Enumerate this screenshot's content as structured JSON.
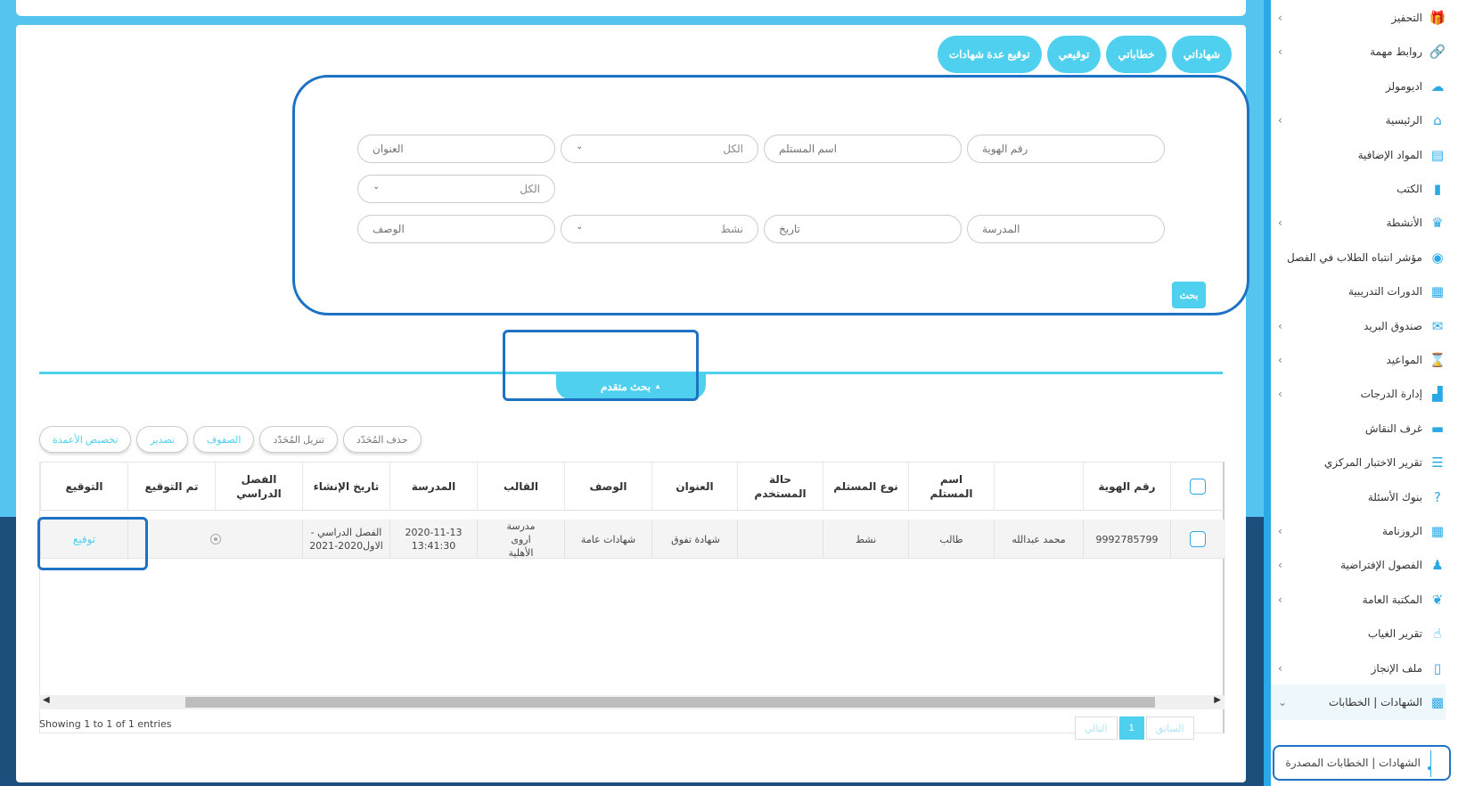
{
  "sidebar": {
    "items": [
      {
        "label": "التحفيز",
        "icon": "gift-icon",
        "chevron": true
      },
      {
        "label": "روابط مهمة",
        "icon": "link-icon",
        "chevron": true
      },
      {
        "label": "اديومولز",
        "icon": "cloud-icon",
        "chevron": false
      },
      {
        "label": "الرئيسية",
        "icon": "home-icon",
        "chevron": true
      },
      {
        "label": "المواد الإضافية",
        "icon": "documents-icon",
        "chevron": false
      },
      {
        "label": "الكتب",
        "icon": "book-icon",
        "chevron": false
      },
      {
        "label": "الأنشطة",
        "icon": "trophy-icon",
        "chevron": true
      },
      {
        "label": "مؤشر انتباه الطلاب في الفصل",
        "icon": "eye-icon",
        "chevron": false
      },
      {
        "label": "الدورات التدريبية",
        "icon": "grid-icon",
        "chevron": false
      },
      {
        "label": "صندوق البريد",
        "icon": "mail-icon",
        "chevron": true
      },
      {
        "label": "المواعيد",
        "icon": "hourglass-icon",
        "chevron": true
      },
      {
        "label": "إدارة الدرجات",
        "icon": "bar-chart-icon",
        "chevron": true
      },
      {
        "label": "غرف النقاش",
        "icon": "chat-icon",
        "chevron": false
      },
      {
        "label": "تقرير الاختبار المركزي",
        "icon": "list-icon",
        "chevron": false
      },
      {
        "label": "بنوك الأسئلة",
        "icon": "question-icon",
        "chevron": false
      },
      {
        "label": "الروزنامة",
        "icon": "calendar-icon",
        "chevron": true
      },
      {
        "label": "الفصول الإفتراضية",
        "icon": "users-icon",
        "chevron": true
      },
      {
        "label": "المكتبة العامة",
        "icon": "leaf-icon",
        "chevron": true
      },
      {
        "label": "تقرير الغياب",
        "icon": "hand-icon",
        "chevron": false
      },
      {
        "label": "ملف الإنجاز",
        "icon": "file-icon",
        "chevron": true
      },
      {
        "label": "الشهادات | الخطابات",
        "icon": "qr-icon",
        "chevron": true
      }
    ],
    "sub_item": "الشهادات | الخطابات المصدرة"
  },
  "tabs": [
    "شهاداتي",
    "خطاباتي",
    "توقيعي",
    "توقيع عدة شهادات"
  ],
  "filters": {
    "id_number": "رقم الهوية",
    "recipient_name": "اسم المستلم",
    "type_select": "الكل",
    "title": "العنوان",
    "second_select": "الكل",
    "school": "المدرسة",
    "date": "تاريخ",
    "status_select": "نشط",
    "description": "الوصف",
    "search_button": "بحث"
  },
  "advanced_search": "بحث متقدم",
  "actions": {
    "delete_selected": "حذف المُحَدّد",
    "download_selected": "تنزيل المُحَدّد",
    "rows": "الصفوف",
    "export": "تصدير",
    "customize_columns": "تخصيص الأعمدة"
  },
  "table": {
    "headers": {
      "id_number": "رقم الهوية",
      "recipient_name": "اسم المستلم",
      "recipient_type": "نوع المستلم",
      "user_status": "حالة المستخدم",
      "title": "العنوان",
      "description": "الوصف",
      "template": "القالب",
      "school": "المدرسة",
      "created_at": "تاريخ الإنشاء",
      "semester": "الفصل الدراسي",
      "signed": "تم التوقيع",
      "signature": "التوقيع"
    },
    "rows": [
      {
        "id_number": "9992785799",
        "recipient_name": "محمد عبدالله",
        "recipient_type": "طالب",
        "user_status": "نشط",
        "title": "",
        "description": "شهادة تفوق",
        "template": "شهادات عامة",
        "school": "مدرسة اروى الأهلية",
        "created_date": "2020-11-13",
        "created_time": "13:41:30",
        "semester_line1": "- الفصل الدراسي",
        "semester_line2": "الاول2020-2021",
        "sign_link": "توقيع"
      }
    ]
  },
  "footer": {
    "showing": "Showing 1 to 1 of 1 entries",
    "prev": "السابق",
    "page": "1",
    "next": "التالي"
  }
}
